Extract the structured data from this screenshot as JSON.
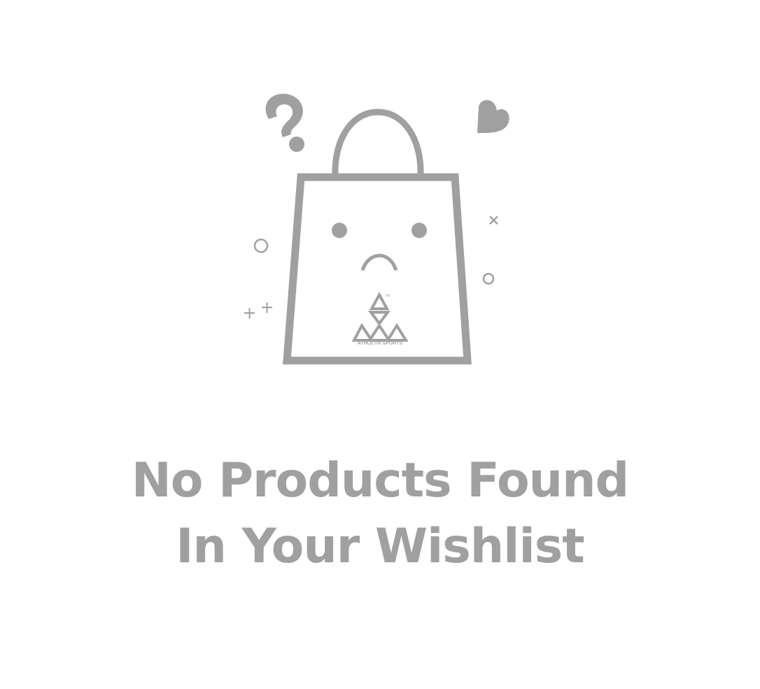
{
  "empty_state": {
    "illustration": {
      "icon": "sad-shopping-bag-icon",
      "decorations": [
        "question-mark-icon",
        "heart-icon",
        "circle-icon",
        "cross-icon",
        "plus-icon"
      ],
      "logo": {
        "name": "athletix-sports-logo",
        "text": "ATHLETIX SPORTS",
        "trademark": "TM"
      },
      "color": "#a0a0a0"
    },
    "message_line_1": "No Products Found",
    "message_line_2": "In Your Wishlist"
  }
}
